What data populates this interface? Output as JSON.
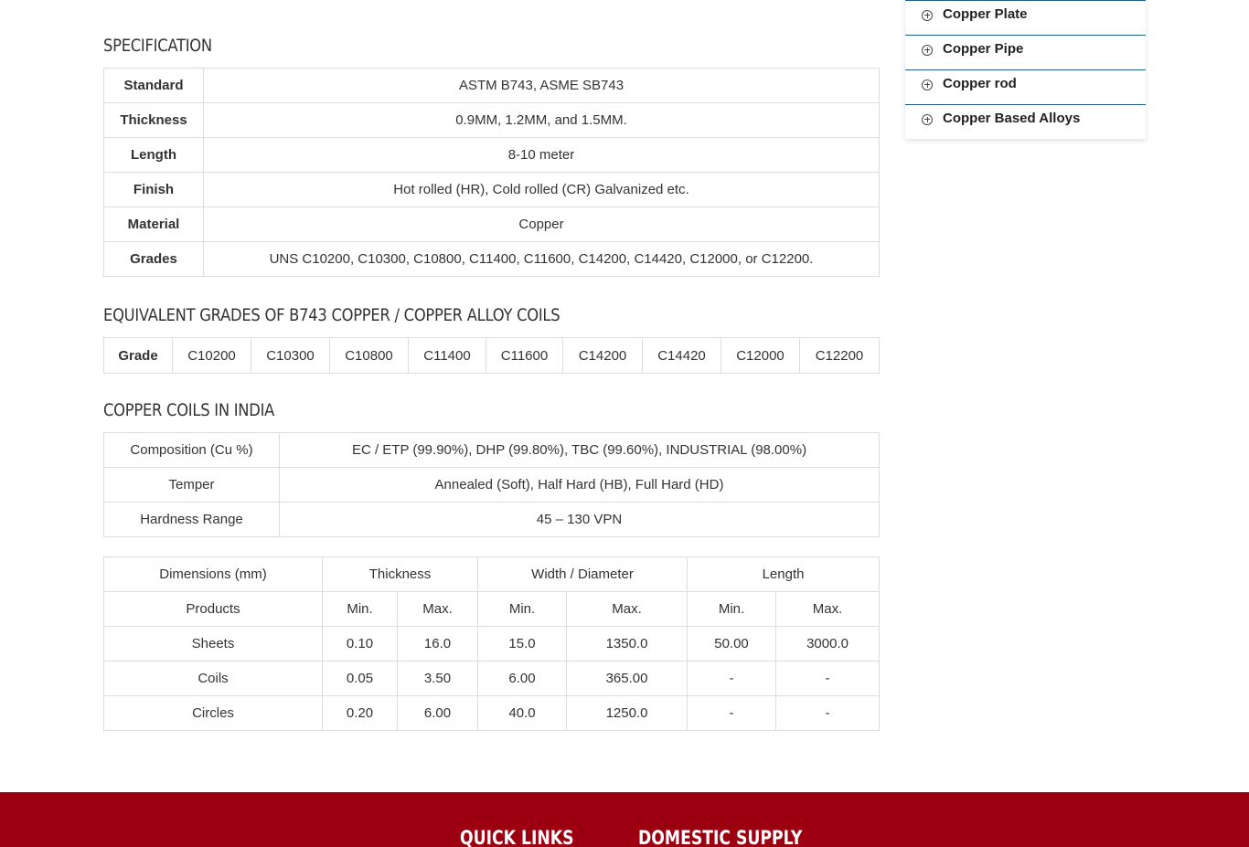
{
  "specification": {
    "title": "SPECIFICATION",
    "rows": [
      {
        "label": "Standard",
        "value": "ASTM B743, ASME SB743"
      },
      {
        "label": "Thickness",
        "value": "0.9MM, 1.2MM, and 1.5MM."
      },
      {
        "label": "Length",
        "value": "8-10 meter"
      },
      {
        "label": "Finish",
        "value": "Hot rolled (HR), Cold rolled (CR) Galvanized etc."
      },
      {
        "label": "Material",
        "value": "Copper"
      },
      {
        "label": "Grades",
        "value": "UNS C10200, C10300, C10800, C11400, C11600, C14200, C14420, C12000, or C12200."
      }
    ]
  },
  "equivalent": {
    "title": "EQUIVALENT GRADES OF B743 COPPER / COPPER ALLOY COILS",
    "label": "Grade",
    "grades": [
      "C10200",
      "C10300",
      "C10800",
      "C11400",
      "C11600",
      "C14200",
      "C14420",
      "C12000",
      "C12200"
    ]
  },
  "india": {
    "title": "COPPER COILS IN INDIA",
    "rows": [
      {
        "label": "Composition (Cu %)",
        "value": "EC / ETP (99.90%), DHP (99.80%), TBC (99.60%), INDUSTRIAL (98.00%)"
      },
      {
        "label": "Temper",
        "value": "Annealed (Soft), Half Hard (HB), Full Hard (HD)"
      },
      {
        "label": "Hardness Range",
        "value": "45 – 130 VPN"
      }
    ]
  },
  "dimensions": {
    "headers": [
      "Dimensions (mm)",
      "Thickness",
      "Width / Diameter",
      "Length"
    ],
    "subheaders": [
      "Products",
      "Min.",
      "Max.",
      "Min.",
      "Max.",
      "Min.",
      "Max."
    ],
    "rows": [
      [
        "Sheets",
        "0.10",
        "16.0",
        "15.0",
        "1350.0",
        "50.00",
        "3000.0"
      ],
      [
        "Coils",
        "0.05",
        "3.50",
        "6.00",
        "365.00",
        "-",
        "-"
      ],
      [
        "Circles",
        "0.20",
        "6.00",
        "40.0",
        "1250.0",
        "-",
        "-"
      ]
    ]
  },
  "sidebar": {
    "items": [
      {
        "label": "Copper Plate",
        "icon": "plus-circle-icon"
      },
      {
        "label": "Copper Pipe",
        "icon": "plus-circle-icon"
      },
      {
        "label": "Copper rod",
        "icon": "plus-circle-icon"
      },
      {
        "label": "Copper Based Alloys",
        "icon": "plus-circle-icon"
      }
    ]
  },
  "footer": {
    "quick_links": "QUICK LINKS",
    "domestic_supply": "DOMESTIC SUPPLY",
    "background_color": "#9c0010"
  }
}
